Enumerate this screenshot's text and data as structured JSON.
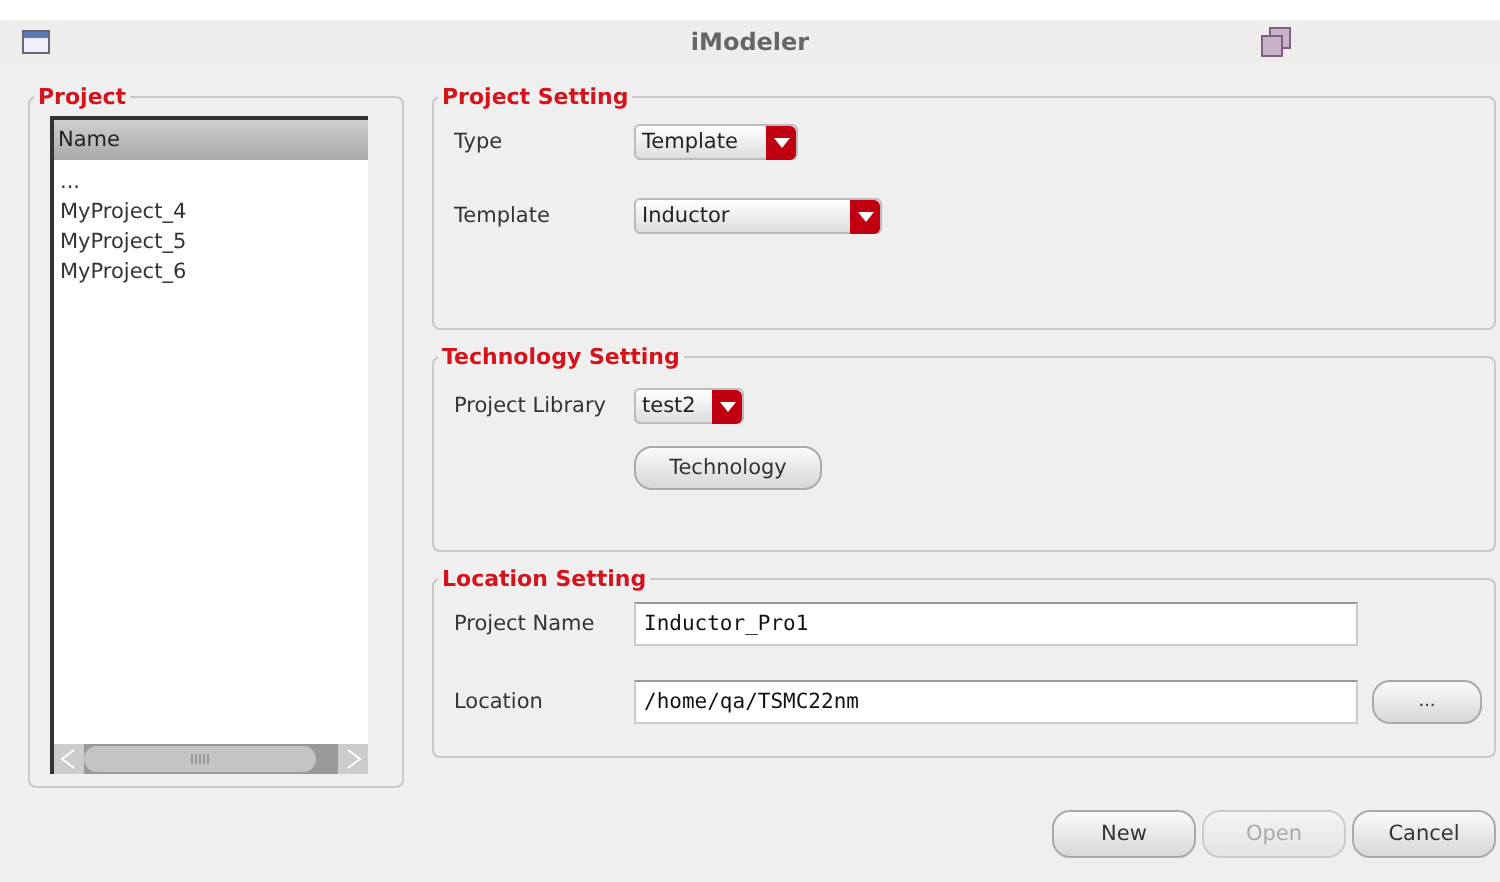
{
  "window": {
    "title": "iModeler"
  },
  "project": {
    "title": "Project",
    "column": "Name",
    "rows": [
      {
        "label": "..."
      },
      {
        "label": "MyProject_4"
      },
      {
        "label": "MyProject_5"
      },
      {
        "label": "MyProject_6"
      }
    ]
  },
  "project_setting": {
    "title": "Project Setting",
    "fields": [
      {
        "label": "Type",
        "value": "Template"
      },
      {
        "label": "Template",
        "value": "Inductor"
      }
    ]
  },
  "technology_setting": {
    "title": "Technology Setting",
    "library_label": "Project Library",
    "library_value": "test2",
    "button": "Technology"
  },
  "location_setting": {
    "title": "Location Setting",
    "name_label": "Project Name",
    "name_value": "Inductor_Pro1",
    "location_label": "Location",
    "location_value": "/home/qa/TSMC22nm",
    "browse_button": "..."
  },
  "buttons": [
    {
      "label": "New",
      "disabled": false
    },
    {
      "label": "Open",
      "disabled": true
    },
    {
      "label": "Cancel",
      "disabled": false
    }
  ]
}
